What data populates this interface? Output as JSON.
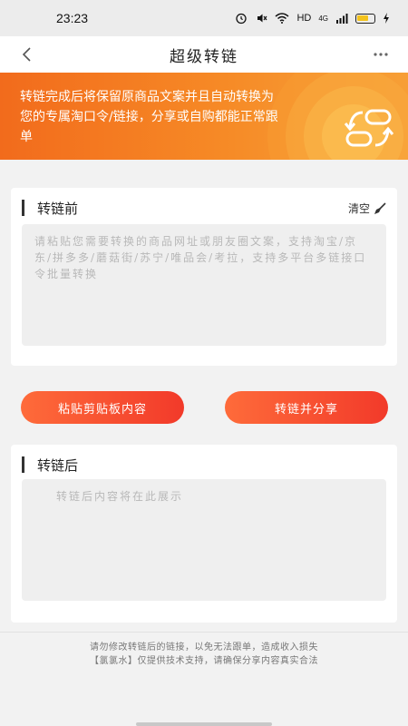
{
  "status": {
    "time": "23:23",
    "network": "HD",
    "signal": "4G"
  },
  "nav": {
    "title": "超级转链",
    "back_icon": "chevron-left-icon",
    "more_icon": "more-dots-icon"
  },
  "banner": {
    "text": "转链完成后将保留原商品文案并且自动转换为您的专属淘口令/链接，分享或自购都能正常跟单",
    "icon": "link-convert-icon"
  },
  "before": {
    "title": "转链前",
    "clear_label": "清空",
    "clear_icon": "broom-icon",
    "placeholder": "请粘贴您需要转换的商品网址或朋友圈文案，支持淘宝/京东/拼多多/蘑菇街/苏宁/唯品会/考拉，支持多平台多链接口令批量转换"
  },
  "buttons": {
    "paste_label": "粘贴剪贴板内容",
    "convert_label": "转链并分享"
  },
  "after": {
    "title": "转链后",
    "placeholder": "转链后内容将在此展示"
  },
  "footer": {
    "line1": "请勿修改转链后的链接，以免无法跟单，造成收入损失",
    "line2": "【氯氯水】仅提供技术支持，请确保分享内容真实合法"
  },
  "colors": {
    "banner_start": "#f26b1c",
    "banner_end": "#f6a33c",
    "button_start": "#fe6b3a",
    "button_end": "#f23a2a"
  }
}
